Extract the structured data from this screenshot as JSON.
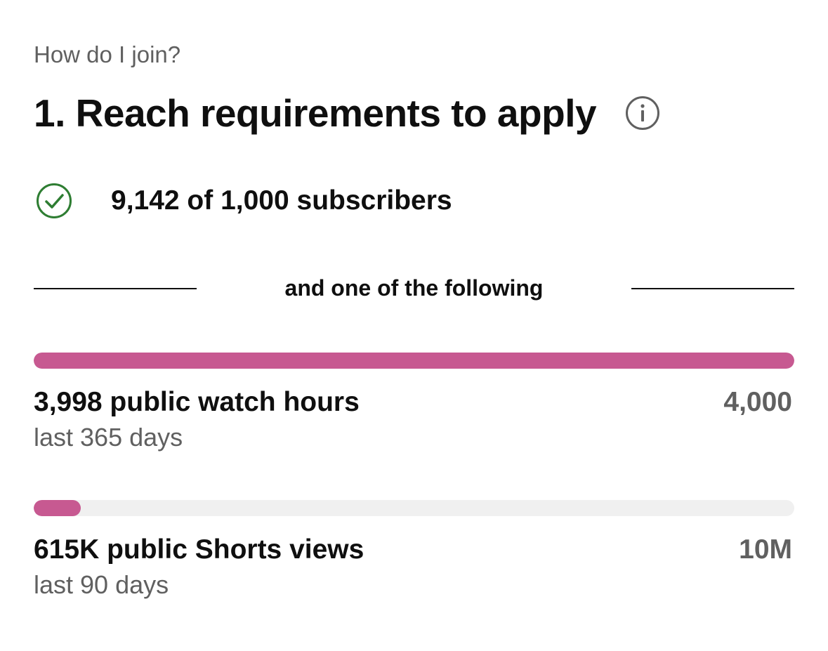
{
  "header": {
    "kicker": "How do I join?",
    "title": "1. Reach requirements to apply",
    "info_icon": "info-circle-icon"
  },
  "subscribers": {
    "icon": "check-circle-icon",
    "text": "9,142 of 1,000 subscribers",
    "icon_color": "#2e7d32"
  },
  "divider": {
    "label": "and one of the following"
  },
  "metrics": [
    {
      "label": "3,998 public watch hours",
      "period": "last 365 days",
      "target": "4,000",
      "progress": 0.9995
    },
    {
      "label": "615K public Shorts views",
      "period": "last 90 days",
      "target": "10M",
      "progress": 0.0615
    }
  ],
  "colors": {
    "progress_fill": "#c75991",
    "progress_track": "#f0f0f0",
    "secondary_text": "#606060"
  }
}
